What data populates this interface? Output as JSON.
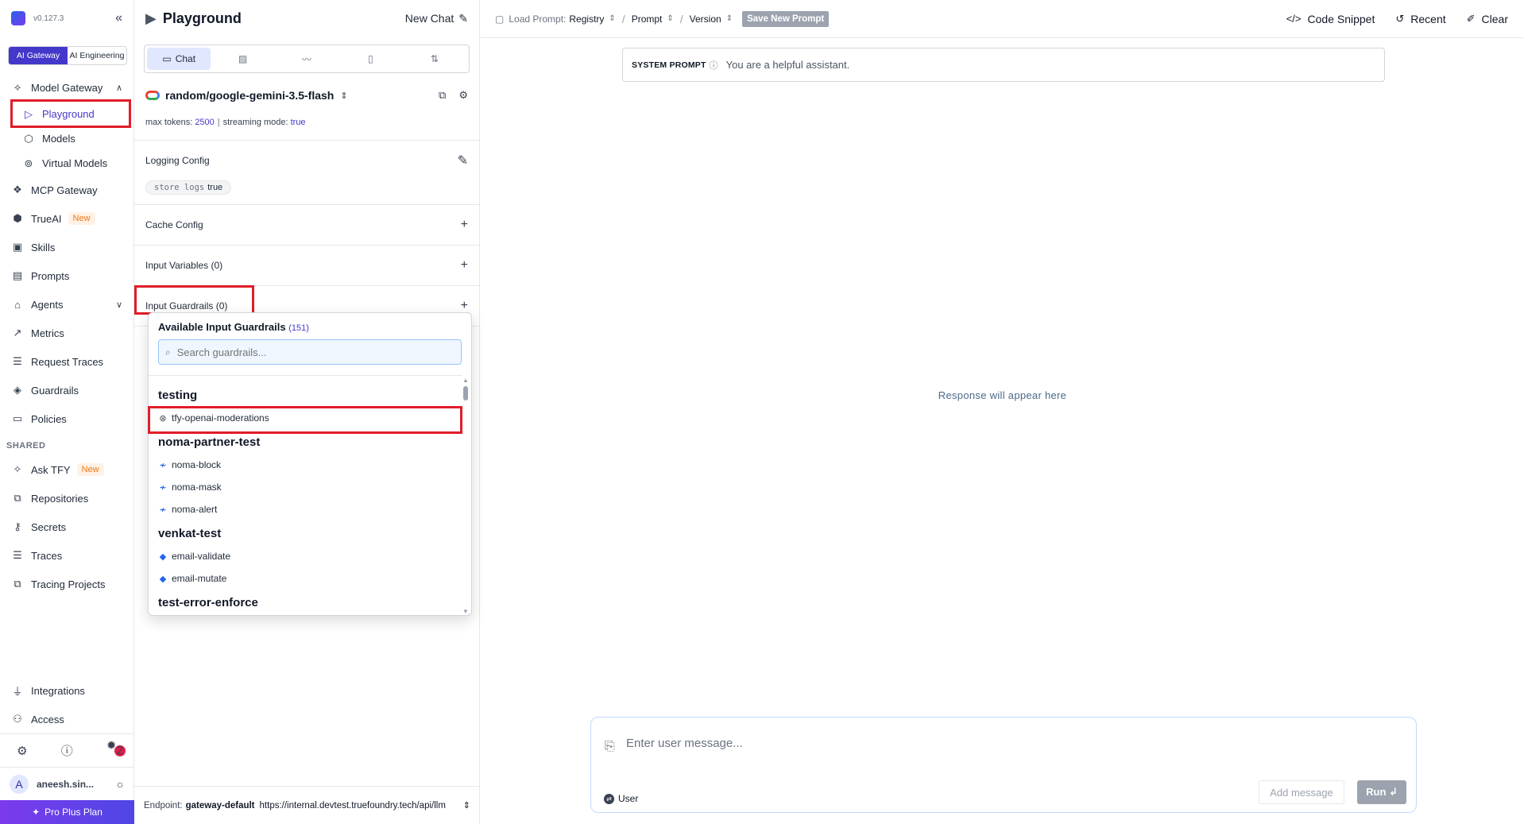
{
  "nav": {
    "version": "v0.127.3",
    "collapse_icon": "«",
    "segments": [
      "AI Gateway",
      "AI Engineering"
    ],
    "items": [
      {
        "label": "Model Gateway",
        "icon": "⟡",
        "chevron": "∧"
      },
      {
        "label": "Playground",
        "icon": "▷"
      },
      {
        "label": "Models",
        "icon": "⬡"
      },
      {
        "label": "Virtual Models",
        "icon": "⊚"
      },
      {
        "label": "MCP Gateway",
        "icon": "❖"
      },
      {
        "label": "TrueAI",
        "icon": "⬢",
        "badge": "New"
      },
      {
        "label": "Skills",
        "icon": "▣"
      },
      {
        "label": "Prompts",
        "icon": "▤"
      },
      {
        "label": "Agents",
        "icon": "⌂",
        "chevron": "∨"
      },
      {
        "label": "Metrics",
        "icon": "↗"
      },
      {
        "label": "Request Traces",
        "icon": "☰"
      },
      {
        "label": "Guardrails",
        "icon": "◈"
      },
      {
        "label": "Policies",
        "icon": "▭"
      }
    ],
    "shared_label": "SHARED",
    "shared_items": [
      {
        "label": "Ask TFY",
        "icon": "✧",
        "badge": "New"
      },
      {
        "label": "Repositories",
        "icon": "⧉"
      },
      {
        "label": "Secrets",
        "icon": "⚷"
      },
      {
        "label": "Traces",
        "icon": "☰"
      },
      {
        "label": "Tracing Projects",
        "icon": "⧉"
      }
    ],
    "bottom_items": [
      {
        "label": "Integrations",
        "icon": "⏚"
      },
      {
        "label": "Access",
        "icon": "⚇"
      }
    ],
    "notif_count": "2",
    "user_initial": "A",
    "user_name": "aneesh.sin...",
    "plan": "Pro Plus Plan"
  },
  "panel": {
    "title": "Playground",
    "new_chat": "New Chat",
    "tabs": [
      "Chat",
      "▨",
      "〰",
      "▯",
      "⇅"
    ],
    "model": "random/google-gemini-3.5-flash",
    "max_tokens_label": "max tokens:",
    "max_tokens": "2500",
    "streaming_label": "streaming mode:",
    "streaming": "true",
    "logging_config": "Logging Config",
    "store_logs_key": "store logs",
    "store_logs_val": "true",
    "cache_config": "Cache Config",
    "input_variables": "Input Variables (0)",
    "input_guardrails": "Input Guardrails (0)",
    "endpoint_label": "Endpoint:",
    "endpoint_name": "gateway-default",
    "endpoint_url": "https://internal.devtest.truefoundry.tech/api/llm"
  },
  "dropdown": {
    "title": "Available Input Guardrails",
    "count": "(151)",
    "search_placeholder": "Search guardrails...",
    "groups": [
      {
        "name": "testing",
        "options": [
          {
            "label": "tfy-openai-moderations",
            "icon": "openai"
          }
        ]
      },
      {
        "name": "noma-partner-test",
        "options": [
          {
            "label": "noma-block",
            "icon": "noma"
          },
          {
            "label": "noma-mask",
            "icon": "noma"
          },
          {
            "label": "noma-alert",
            "icon": "noma"
          }
        ]
      },
      {
        "name": "venkat-test",
        "options": [
          {
            "label": "email-validate",
            "icon": "tfy"
          },
          {
            "label": "email-mutate",
            "icon": "tfy"
          }
        ]
      },
      {
        "name": "test-error-enforce",
        "options": []
      }
    ]
  },
  "main": {
    "load_prompt_label": "Load Prompt:",
    "registry": "Registry",
    "prompt": "Prompt",
    "version": "Version",
    "save_prompt": "Save New Prompt",
    "code_snippet": "Code Snippet",
    "recent": "Recent",
    "clear": "Clear",
    "system_prompt_label": "SYSTEM PROMPT",
    "system_prompt": "You are a helpful assistant.",
    "response_placeholder": "Response will appear here",
    "message_placeholder": "Enter user message...",
    "role": "User",
    "add_message": "Add message",
    "run": "Run ↲"
  },
  "colors": {
    "accent": "#4338ca",
    "highlight": "#e11d2a",
    "new_badge": "#ea7a17"
  }
}
